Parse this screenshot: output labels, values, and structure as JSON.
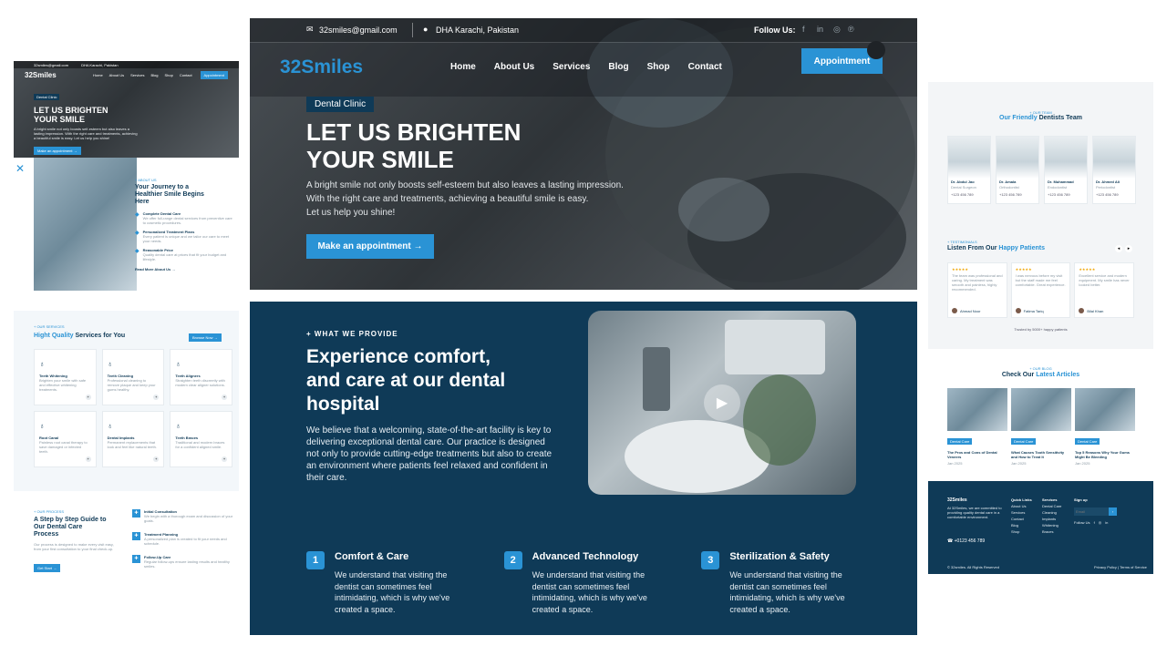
{
  "hero": {
    "email": "32smiles@gmail.com",
    "location": "DHA Karachi, Pakistan",
    "follow_us": "Follow Us:",
    "logo": "32Smiles",
    "nav": [
      "Home",
      "About Us",
      "Services",
      "Blog",
      "Shop",
      "Contact"
    ],
    "cta": "Appointment",
    "badge": "Dental Clinic",
    "title_line1": "LET US BRIGHTEN",
    "title_line2": "YOUR SMILE",
    "desc_line1": "A bright smile not only boosts self-esteem but also leaves a lasting impression.",
    "desc_line2": "With the right care and treatments, achieving a beautiful smile is easy.",
    "desc_line3": "Let us help you shine!",
    "button": "Make an appointment →"
  },
  "services": {
    "kicker": "+ WHAT WE PROVIDE",
    "title_line1": "Experience comfort,",
    "title_line2": "and care at our dental",
    "title_line3": "hospital",
    "paragraph": "We believe that a welcoming, state-of-the-art facility is key to delivering exceptional dental care. Our practice is designed not only to provide cutting-edge treatments but also to create an environment where patients feel relaxed and confident in their care.",
    "features": [
      {
        "num": "1",
        "title": "Comfort & Care",
        "text": "We understand that visiting the dentist can sometimes feel intimidating, which is why we've created a space."
      },
      {
        "num": "2",
        "title": "Advanced Technology",
        "text": "We understand that visiting the dentist can sometimes feel intimidating, which is why we've created a space."
      },
      {
        "num": "3",
        "title": "Sterilization & Safety",
        "text": "We understand that visiting the dentist can sometimes feel intimidating, which is why we've created a space."
      }
    ]
  },
  "left": {
    "top_email": "32smiles@gmail.com",
    "top_loc": "DHA Karachi, Pakistan",
    "logo": "32Smiles",
    "nav": [
      "Home",
      "About Us",
      "Services",
      "Blog",
      "Shop",
      "Contact"
    ],
    "cta": "Appointment",
    "badge": "Dental Clinic",
    "title_line1": "LET US BRIGHTEN",
    "title_line2": "YOUR SMILE",
    "desc": "A bright smile not only boosts self-esteem but also leaves a lasting impression. With the right care and treatments, achieving a beautiful smile is easy. Let us help you shine!",
    "button": "Make an appointment →",
    "journey_kicker": "+ ABOUT US",
    "journey_title_a": "Your Journey to a",
    "journey_title_b": "Healthier Smile Begins",
    "journey_title_c": "Here",
    "journey_items": [
      {
        "title": "Complete Dental Care",
        "text": "We offer full-range dental services from preventive care to cosmetic procedures."
      },
      {
        "title": "Personalized Treatment Plans",
        "text": "Every patient is unique and we tailor our care to meet your needs."
      },
      {
        "title": "Reasonable Price",
        "text": "Quality dental care at prices that fit your budget and lifestyle."
      }
    ],
    "read_more": "Read More About Us →",
    "hq_kicker": "+ OUR SERVICES",
    "hq_title_a": "Hight Quality",
    "hq_title_b": "Services for You",
    "hq_button": "Browse Now →",
    "hq_items": [
      {
        "title": "Teeth Whitening",
        "text": "Brighten your smile with safe and effective whitening treatments."
      },
      {
        "title": "Teeth Cleaning",
        "text": "Professional cleaning to remove plaque and keep your gums healthy."
      },
      {
        "title": "Teeth Aligners",
        "text": "Straighten teeth discreetly with modern clear aligner solutions."
      },
      {
        "title": "Root Canal",
        "text": "Painless root canal therapy to save damaged or infected teeth."
      },
      {
        "title": "Dental Implants",
        "text": "Permanent replacements that look and feel like natural teeth."
      },
      {
        "title": "Teeth Braces",
        "text": "Traditional and modern braces for a confident aligned smile."
      }
    ],
    "guide_kicker": "+ OUR PROCESS",
    "guide_title_a": "A Step by Step Guide to",
    "guide_title_b": "Our Dental Care",
    "guide_title_c": "Process",
    "guide_text": "Our process is designed to make every visit easy, from your first consultation to your final check-up.",
    "guide_button": "Get Start →",
    "guide_steps": [
      {
        "title": "Initial Consultation",
        "text": "We begin with a thorough exam and discussion of your goals."
      },
      {
        "title": "Treatment Planning",
        "text": "A personalized plan is created to fit your needs and schedule."
      },
      {
        "title": "Follow-Up Care",
        "text": "Regular follow-ups ensure lasting results and healthy smiles."
      }
    ]
  },
  "right": {
    "team_kicker": "+ OUR TEAM",
    "team_title_a": "Our Friendly",
    "team_title_b": "Dentists Team",
    "team": [
      {
        "name": "Dr. Abdul Jao",
        "role": "Dental Surgeon",
        "phone": "+123 456 789"
      },
      {
        "name": "Dr. Amala",
        "role": "Orthodontist",
        "phone": "+123 456 789"
      },
      {
        "name": "Dr. Muhammad",
        "role": "Endodontist",
        "phone": "+123 456 789"
      },
      {
        "name": "Dr. Ahmed Ali",
        "role": "Periodontist",
        "phone": "+123 456 789"
      }
    ],
    "test_kicker": "+ TESTIMONIALS",
    "test_title_a": "Listen From Our",
    "test_title_b": "Happy Patients",
    "testimonials": [
      {
        "text": "The team was professional and caring. My treatment was smooth and painless, highly recommended.",
        "name": "Ahmad Noor"
      },
      {
        "text": "I was nervous before my visit but the staff made me feel comfortable. Great experience.",
        "name": "Fatima Tariq"
      },
      {
        "text": "Excellent service and modern equipment. My smile has never looked better.",
        "name": "Bilal Khan"
      }
    ],
    "test_footer": "Trusted by 5000+ happy patients",
    "articles_kicker": "+ OUR BLOG",
    "articles_title_a": "Check Our",
    "articles_title_b": "Latest Articles",
    "articles": [
      {
        "tag": "Dental Care",
        "title": "The Pros and Cons of Dental Veneers",
        "meta": "Jan 2025"
      },
      {
        "tag": "Dental Care",
        "title": "What Causes Tooth Sensitivity and How to Treat It",
        "meta": "Jan 2025"
      },
      {
        "tag": "Dental Care",
        "title": "Top 5 Reasons Why Your Gums Might Be Bleeding",
        "meta": "Jan 2025"
      }
    ],
    "footer_logo": "32Smiles",
    "footer_text": "At 32Smiles, we are committed to providing quality dental care in a comfortable environment.",
    "footer_phone": "+0123 456 789",
    "footer_quick": "Quick Links",
    "footer_quick_items": [
      "About Us",
      "Services",
      "Contact",
      "Blog",
      "Shop"
    ],
    "footer_services": "Services",
    "footer_services_items": [
      "Dental Care",
      "Cleaning",
      "Implants",
      "Whitening",
      "Braces"
    ],
    "footer_signup": "Sign up",
    "footer_email_placeholder": "Email",
    "footer_follow": "Follow Us",
    "footer_copy": "© 32smiles. All Rights Reserved",
    "footer_policy": "Privacy Policy | Terms of Service"
  }
}
